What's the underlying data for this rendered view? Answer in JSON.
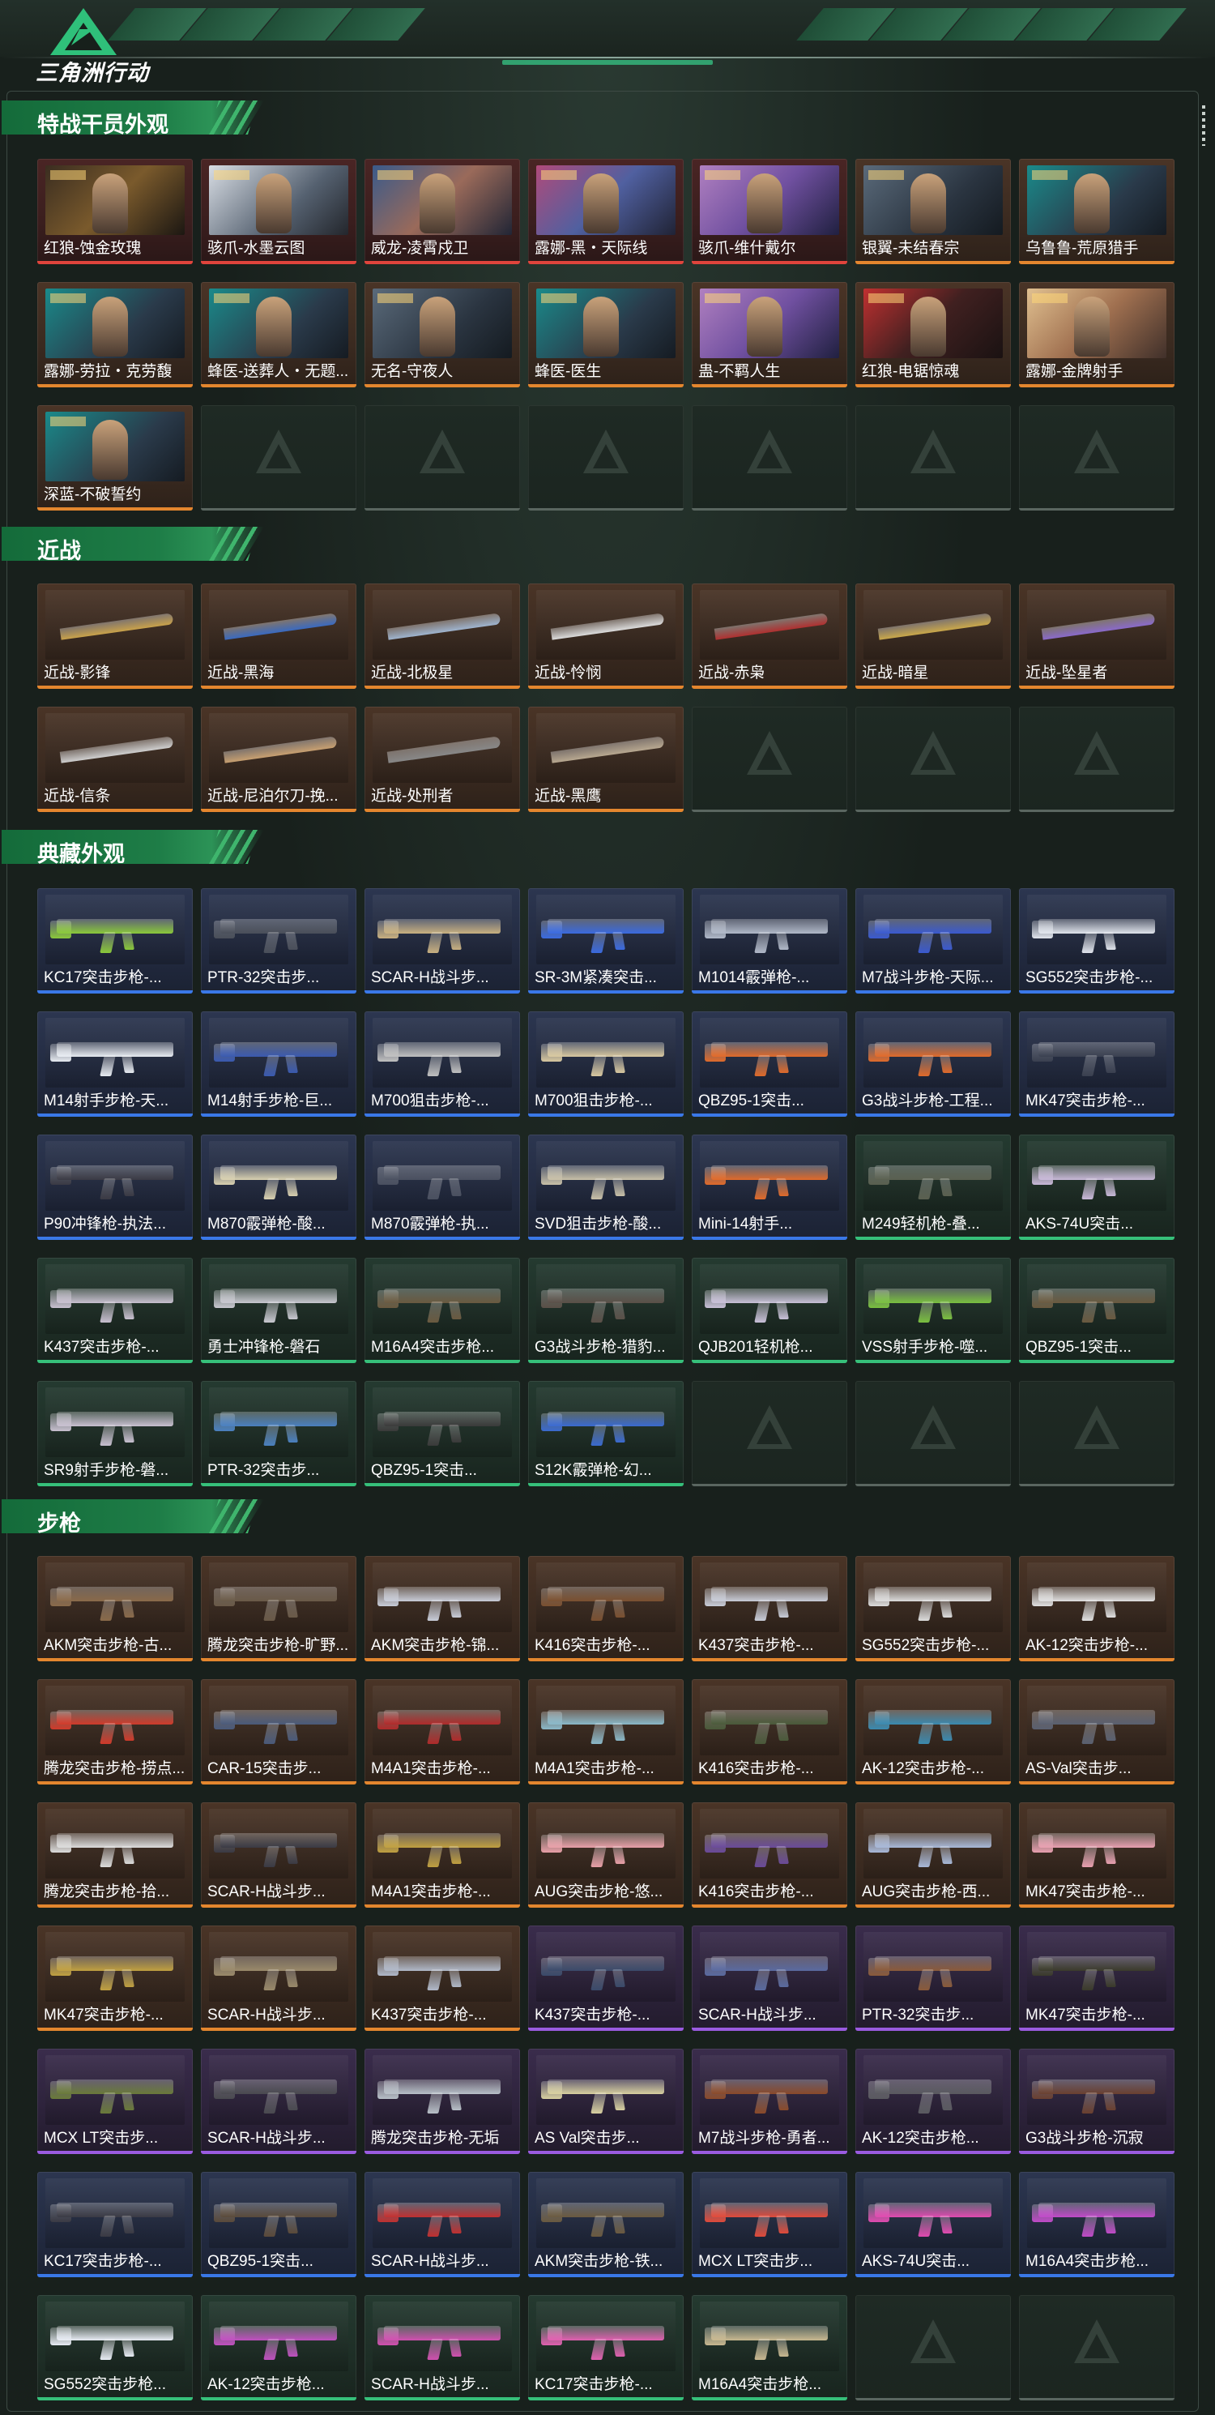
{
  "header": {
    "brand": "三角洲行动"
  },
  "sections": [
    {
      "title": "特战干员外观",
      "kind": "operator",
      "items": [
        {
          "label": "红狼-蚀金玫瑰",
          "rarity": "red",
          "art": "c1"
        },
        {
          "label": "骇爪-水墨云图",
          "rarity": "red",
          "art": "c2"
        },
        {
          "label": "威龙-凌霄戍卫",
          "rarity": "red",
          "art": "c3"
        },
        {
          "label": "露娜-黑・天际线",
          "rarity": "red",
          "art": "c4"
        },
        {
          "label": "骇爪-维什戴尔",
          "rarity": "red",
          "art": "c7"
        },
        {
          "label": "银翼-未结春宗",
          "rarity": "gold",
          "art": "c5"
        },
        {
          "label": "乌鲁鲁-荒原猎手",
          "rarity": "gold",
          "art": "c6"
        },
        {
          "label": "露娜-劳拉・克劳馥",
          "rarity": "gold",
          "art": "c6"
        },
        {
          "label": "蜂医-送葬人・无题...",
          "rarity": "gold",
          "art": "c6"
        },
        {
          "label": "无名-守夜人",
          "rarity": "gold",
          "art": "c5"
        },
        {
          "label": "蜂医-医生",
          "rarity": "gold",
          "art": "c6"
        },
        {
          "label": "蛊-不羁人生",
          "rarity": "gold",
          "art": "c7"
        },
        {
          "label": "红狼-电锯惊魂",
          "rarity": "gold",
          "art": "c8"
        },
        {
          "label": "露娜-金牌射手",
          "rarity": "gold",
          "art": "c9"
        },
        {
          "label": "深蓝-不破誓约",
          "rarity": "gold",
          "art": "c6"
        }
      ],
      "empty_slots": 6
    },
    {
      "title": "近战",
      "kind": "knife",
      "items": [
        {
          "label": "近战-影锋",
          "rarity": "gold",
          "color": "#c9a24a"
        },
        {
          "label": "近战-黑海",
          "rarity": "gold",
          "color": "#3a6ac0"
        },
        {
          "label": "近战-北极星",
          "rarity": "gold",
          "color": "#9fb4cf"
        },
        {
          "label": "近战-怜悯",
          "rarity": "gold",
          "color": "#dcdcdc"
        },
        {
          "label": "近战-赤枭",
          "rarity": "gold",
          "color": "#b03030"
        },
        {
          "label": "近战-暗星",
          "rarity": "gold",
          "color": "#caa84a"
        },
        {
          "label": "近战-坠星者",
          "rarity": "gold",
          "color": "#8a6acb"
        },
        {
          "label": "近战-信条",
          "rarity": "gold",
          "color": "#cfcfcf"
        },
        {
          "label": "近战-尼泊尔刀-挽...",
          "rarity": "gold",
          "color": "#c8a070"
        },
        {
          "label": "近战-处刑者",
          "rarity": "gold",
          "color": "#888888"
        },
        {
          "label": "近战-黑鹰",
          "rarity": "gold",
          "color": "#b8a890"
        }
      ],
      "empty_slots": 3
    },
    {
      "title": "典藏外观",
      "kind": "gun",
      "items": [
        {
          "label": "KC17突击步枪-...",
          "rarity": "blue",
          "color": "#8ac83a"
        },
        {
          "label": "PTR-32突击步...",
          "rarity": "blue",
          "color": "#4a4f5a"
        },
        {
          "label": "SCAR-H战斗步...",
          "rarity": "blue",
          "color": "#c8b080"
        },
        {
          "label": "SR-3M紧凑突击...",
          "rarity": "blue",
          "color": "#3a6ae0"
        },
        {
          "label": "M1014霰弹枪-...",
          "rarity": "blue",
          "color": "#b0b8c8"
        },
        {
          "label": "M7战斗步枪-天际...",
          "rarity": "blue",
          "color": "#3a5ad0"
        },
        {
          "label": "SG552突击步枪-...",
          "rarity": "blue",
          "color": "#e0e4ec"
        },
        {
          "label": "M14射手步枪-天...",
          "rarity": "blue",
          "color": "#e8ecf2"
        },
        {
          "label": "M14射手步枪-巨...",
          "rarity": "blue",
          "color": "#3a5ab0"
        },
        {
          "label": "M700狙击步枪-...",
          "rarity": "blue",
          "color": "#c0c0c0"
        },
        {
          "label": "M700狙击步枪-...",
          "rarity": "blue",
          "color": "#d8c8a0"
        },
        {
          "label": "QBZ95-1突击...",
          "rarity": "blue",
          "color": "#e06a2a"
        },
        {
          "label": "G3战斗步枪-工程...",
          "rarity": "blue",
          "color": "#e06a2a"
        },
        {
          "label": "MK47突击步枪-...",
          "rarity": "blue",
          "color": "#3a4050"
        },
        {
          "label": "P90冲锋枪-执法...",
          "rarity": "blue",
          "color": "#3a3a44"
        },
        {
          "label": "M870霰弹枪-酸...",
          "rarity": "blue",
          "color": "#d8d0b0"
        },
        {
          "label": "M870霰弹枪-执...",
          "rarity": "blue",
          "color": "#4a5060"
        },
        {
          "label": "SVD狙击步枪-酸...",
          "rarity": "blue",
          "color": "#c8c0a8"
        },
        {
          "label": "Mini-14射手...",
          "rarity": "blue",
          "color": "#e06a2a"
        },
        {
          "label": "M249轻机枪-叠...",
          "rarity": "green",
          "color": "#5a6050"
        },
        {
          "label": "AKS-74U突击...",
          "rarity": "green",
          "color": "#c8b8d8"
        },
        {
          "label": "K437突击步枪-...",
          "rarity": "green",
          "color": "#c8c0d0"
        },
        {
          "label": "勇士冲锋枪-磐石",
          "rarity": "green",
          "color": "#c8c8d0"
        },
        {
          "label": "M16A4突击步枪...",
          "rarity": "green",
          "color": "#6a5a40"
        },
        {
          "label": "G3战斗步枪-猎豹...",
          "rarity": "green",
          "color": "#5a5048"
        },
        {
          "label": "QJB201轻机枪...",
          "rarity": "green",
          "color": "#c8c0d8"
        },
        {
          "label": "VSS射手步枪-噬...",
          "rarity": "green",
          "color": "#7ac040"
        },
        {
          "label": "QBZ95-1突击...",
          "rarity": "green",
          "color": "#6a5a40"
        },
        {
          "label": "SR9射手步枪-磐...",
          "rarity": "green",
          "color": "#c8c0d0"
        },
        {
          "label": "PTR-32突击步...",
          "rarity": "green",
          "color": "#4a80c0"
        },
        {
          "label": "QBZ95-1突击...",
          "rarity": "green",
          "color": "#3a3a3a"
        },
        {
          "label": "S12K霰弹枪-幻...",
          "rarity": "green",
          "color": "#3a6ad0"
        }
      ],
      "empty_slots": 3
    },
    {
      "title": "步枪",
      "kind": "gun",
      "items": [
        {
          "label": "AKM突击步枪-古...",
          "rarity": "gold",
          "color": "#8a6a4a"
        },
        {
          "label": "腾龙突击步枪-旷野...",
          "rarity": "gold",
          "color": "#6a5a48"
        },
        {
          "label": "AKM突击步枪-锦...",
          "rarity": "gold",
          "color": "#c8ccd8"
        },
        {
          "label": "K416突击步枪-...",
          "rarity": "gold",
          "color": "#7a5030"
        },
        {
          "label": "K437突击步枪-...",
          "rarity": "gold",
          "color": "#c8ccd8"
        },
        {
          "label": "SG552突击步枪-...",
          "rarity": "gold",
          "color": "#dcdcdc"
        },
        {
          "label": "AK-12突击步枪-...",
          "rarity": "gold",
          "color": "#e0e0e0"
        },
        {
          "label": "腾龙突击步枪-捞点...",
          "rarity": "gold",
          "color": "#d03a2a"
        },
        {
          "label": "CAR-15突击步...",
          "rarity": "gold",
          "color": "#4a5a7a"
        },
        {
          "label": "M4A1突击步枪-...",
          "rarity": "gold",
          "color": "#b02a2a"
        },
        {
          "label": "M4A1突击步枪-...",
          "rarity": "gold",
          "color": "#8ab8c8"
        },
        {
          "label": "K416突击步枪-...",
          "rarity": "gold",
          "color": "#4a5a3a"
        },
        {
          "label": "AK-12突击步枪-...",
          "rarity": "gold",
          "color": "#3a8ab0"
        },
        {
          "label": "AS-Val突击步...",
          "rarity": "gold",
          "color": "#5a6070"
        },
        {
          "label": "腾龙突击步枪-拾...",
          "rarity": "gold",
          "color": "#dcdcdc"
        },
        {
          "label": "SCAR-H战斗步...",
          "rarity": "gold",
          "color": "#3a3a44"
        },
        {
          "label": "M4A1突击步枪-...",
          "rarity": "gold",
          "color": "#c0a040"
        },
        {
          "label": "AUG突击步枪-悠...",
          "rarity": "gold",
          "color": "#e8a0a8"
        },
        {
          "label": "K416突击步枪-...",
          "rarity": "gold",
          "color": "#6a4a9a"
        },
        {
          "label": "AUG突击步枪-西...",
          "rarity": "gold",
          "color": "#a8b8d8"
        },
        {
          "label": "MK47突击步枪-...",
          "rarity": "gold",
          "color": "#e8a0b0"
        },
        {
          "label": "MK47突击步枪-...",
          "rarity": "gold",
          "color": "#c0a040"
        },
        {
          "label": "SCAR-H战斗步...",
          "rarity": "gold",
          "color": "#9a8a6a"
        },
        {
          "label": "K437突击步枪-...",
          "rarity": "gold",
          "color": "#b0b8c8"
        },
        {
          "label": "K437突击步枪-...",
          "rarity": "purple",
          "color": "#3a4a6a"
        },
        {
          "label": "SCAR-H战斗步...",
          "rarity": "purple",
          "color": "#5a6aa0"
        },
        {
          "label": "PTR-32突击步...",
          "rarity": "purple",
          "color": "#8a5a3a"
        },
        {
          "label": "MK47突击步枪-...",
          "rarity": "purple",
          "color": "#3a3a2a"
        },
        {
          "label": "MCX LT突击步...",
          "rarity": "purple",
          "color": "#6a7a3a"
        },
        {
          "label": "SCAR-H战斗步...",
          "rarity": "purple",
          "color": "#4a4a50"
        },
        {
          "label": "腾龙突击步枪-无垢",
          "rarity": "purple",
          "color": "#b8c0c8"
        },
        {
          "label": "AS Val突击步...",
          "rarity": "purple",
          "color": "#d8d0a0"
        },
        {
          "label": "M7战斗步枪-勇者...",
          "rarity": "purple",
          "color": "#8a4a2a"
        },
        {
          "label": "AK-12突击步枪...",
          "rarity": "purple",
          "color": "#5a5a60"
        },
        {
          "label": "G3战斗步枪-沉寂",
          "rarity": "purple",
          "color": "#6a4030"
        },
        {
          "label": "KC17突击步枪-...",
          "rarity": "blue",
          "color": "#3a3a44"
        },
        {
          "label": "QBZ95-1突击...",
          "rarity": "blue",
          "color": "#5a4a3a"
        },
        {
          "label": "SCAR-H战斗步...",
          "rarity": "blue",
          "color": "#c03030"
        },
        {
          "label": "AKM突击步枪-铁...",
          "rarity": "blue",
          "color": "#6a5a40"
        },
        {
          "label": "MCX LT突击步...",
          "rarity": "blue",
          "color": "#e04a3a"
        },
        {
          "label": "AKS-74U突击...",
          "rarity": "blue",
          "color": "#e04ab0"
        },
        {
          "label": "M16A4突击步枪...",
          "rarity": "blue",
          "color": "#c04ac8"
        },
        {
          "label": "SG552突击步枪...",
          "rarity": "green",
          "color": "#e8ecf4"
        },
        {
          "label": "AK-12突击步枪...",
          "rarity": "green",
          "color": "#c050c0"
        },
        {
          "label": "SCAR-H战斗步...",
          "rarity": "green",
          "color": "#d050b0"
        },
        {
          "label": "KC17突击步枪-...",
          "rarity": "green",
          "color": "#e060b0"
        },
        {
          "label": "M16A4突击步枪...",
          "rarity": "green",
          "color": "#c8b890"
        }
      ],
      "empty_slots": 2
    }
  ],
  "colors": {
    "accent": "#1e7d47",
    "gold_bar": "#e4862e",
    "red_bar": "#e0443c",
    "purple_bar": "#9a5be0",
    "blue_bar": "#3a78e8",
    "green_bar": "#36c07a"
  }
}
